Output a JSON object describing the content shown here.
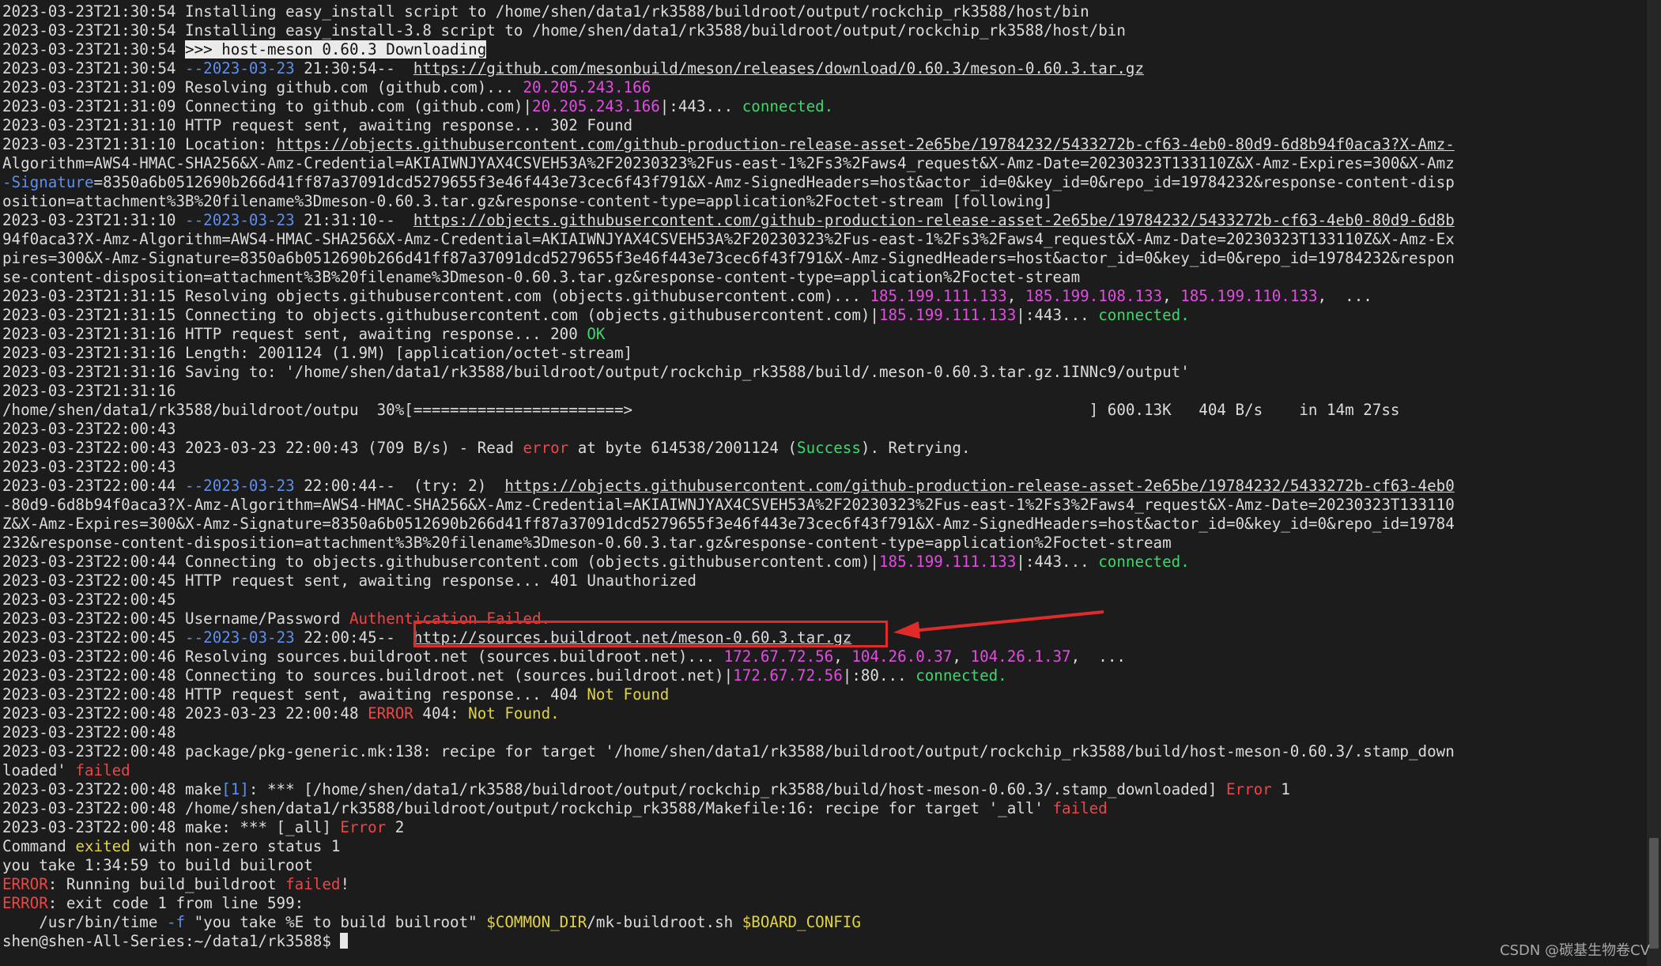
{
  "terminal": {
    "lines": [
      [
        [
          "2023-03-23T21:30:54 Installing easy_install script to /home/shen/data1/rk3588/buildroot/output/rockchip_rk3588/host/bin",
          ""
        ]
      ],
      [
        [
          "2023-03-23T21:30:54 Installing easy_install-3.8 script to /home/shen/data1/rk3588/buildroot/output/rockchip_rk3588/host/bin",
          ""
        ]
      ],
      [
        [
          "2023-03-23T21:30:54 ",
          ""
        ],
        [
          ">>> host-meson 0.60.3 Downloading",
          "hl"
        ]
      ],
      [
        [
          "2023-03-23T21:30:54 ",
          ""
        ],
        [
          "--2023-03-23",
          "c-blue"
        ],
        [
          " 21:30:54--  ",
          ""
        ],
        [
          "https://github.com/mesonbuild/meson/releases/download/0.60.3/meson-0.60.3.tar.gz",
          "url"
        ]
      ],
      [
        [
          "2023-03-23T21:31:09 Resolving github.com (github.com)... ",
          ""
        ],
        [
          "20.205.243.166",
          "c-mag"
        ]
      ],
      [
        [
          "2023-03-23T21:31:09 Connecting to github.com (github.com)|",
          ""
        ],
        [
          "20.205.243.166",
          "c-mag"
        ],
        [
          "|:443... ",
          ""
        ],
        [
          "connected.",
          "c-green"
        ]
      ],
      [
        [
          "2023-03-23T21:31:10 HTTP request sent, awaiting response... 302 Found",
          ""
        ]
      ],
      [
        [
          "2023-03-23T21:31:10 Location: ",
          ""
        ],
        [
          "https://objects.githubusercontent.com/github-production-release-asset-2e65be/19784232/5433272b-cf63-4eb0-80d9-6d8b94f0aca3?X-Amz-",
          "url"
        ]
      ],
      [
        [
          "Algorithm=AWS4-HMAC-SHA256&X-Amz-Credential=AKIAIWNJYAX4CSVEH53A%2F20230323%2Fus-east-1%2Fs3%2Faws4_request&X-Amz-Date=20230323T133110Z&X-Amz-Expires=300&X-Amz",
          ""
        ]
      ],
      [
        [
          "-Signature",
          "c-blue"
        ],
        [
          "=8350a6b0512690b266d41ff87a37091dcd5279655f3e46f443e73cec6f43f791&X-Amz-SignedHeaders=host&actor_id=0&key_id=0&repo_id=19784232&response-content-disp",
          ""
        ]
      ],
      [
        [
          "osition=attachment%3B%20filename%3Dmeson-0.60.3.tar.gz&response-content-type=application%2Foctet-stream [following]",
          ""
        ]
      ],
      [
        [
          "2023-03-23T21:31:10 ",
          ""
        ],
        [
          "--2023-03-23",
          "c-blue"
        ],
        [
          " 21:31:10--  ",
          ""
        ],
        [
          "https://objects.githubusercontent.com/github-production-release-asset-2e65be/19784232/5433272b-cf63-4eb0-80d9-6d8b",
          "url"
        ]
      ],
      [
        [
          "94f0aca3?X-Amz-Algorithm=AWS4-HMAC-SHA256&X-Amz-Credential=AKIAIWNJYAX4CSVEH53A%2F20230323%2Fus-east-1%2Fs3%2Faws4_request&X-Amz-Date=20230323T133110Z&X-Amz-Ex",
          ""
        ]
      ],
      [
        [
          "pires=300&X-Amz-Signature=8350a6b0512690b266d41ff87a37091dcd5279655f3e46f443e73cec6f43f791&X-Amz-SignedHeaders=host&actor_id=0&key_id=0&repo_id=19784232&respon",
          ""
        ]
      ],
      [
        [
          "se-content-disposition=attachment%3B%20filename%3Dmeson-0.60.3.tar.gz&response-content-type=application%2Foctet-stream",
          ""
        ]
      ],
      [
        [
          "2023-03-23T21:31:15 Resolving objects.githubusercontent.com (objects.githubusercontent.com)... ",
          ""
        ],
        [
          "185.199.111.133",
          "c-mag"
        ],
        [
          ", ",
          ""
        ],
        [
          "185.199.108.133",
          "c-mag"
        ],
        [
          ", ",
          ""
        ],
        [
          "185.199.110.133",
          "c-mag"
        ],
        [
          ",  ...",
          ""
        ]
      ],
      [
        [
          "2023-03-23T21:31:15 Connecting to objects.githubusercontent.com (objects.githubusercontent.com)|",
          ""
        ],
        [
          "185.199.111.133",
          "c-mag"
        ],
        [
          "|:443... ",
          ""
        ],
        [
          "connected.",
          "c-green"
        ]
      ],
      [
        [
          "2023-03-23T21:31:16 HTTP request sent, awaiting response... 200 ",
          ""
        ],
        [
          "OK",
          "c-green"
        ]
      ],
      [
        [
          "2023-03-23T21:31:16 Length: 2001124 (1.9M) [application/octet-stream]",
          ""
        ]
      ],
      [
        [
          "2023-03-23T21:31:16 Saving to: '/home/shen/data1/rk3588/buildroot/output/rockchip_rk3588/build/.meson-0.60.3.tar.gz.1INNc9/output'",
          ""
        ]
      ],
      [
        [
          "2023-03-23T21:31:16",
          ""
        ]
      ],
      [
        [
          "/home/shen/data1/rk3588/buildroot/outpu  30%[=======================>                                                  ] 600.13K   404 B/s    in 14m 27ss",
          ""
        ]
      ],
      [
        [
          "2023-03-23T22:00:43",
          ""
        ]
      ],
      [
        [
          "2023-03-23T22:00:43 2023-03-23 22:00:43 (709 B/s) - Read ",
          ""
        ],
        [
          "error",
          "c-red"
        ],
        [
          " at byte 614538/2001124 (",
          ""
        ],
        [
          "Success",
          "c-green"
        ],
        [
          "). Retrying.",
          ""
        ]
      ],
      [
        [
          "2023-03-23T22:00:43",
          ""
        ]
      ],
      [
        [
          "2023-03-23T22:00:44 ",
          ""
        ],
        [
          "--2023-03-23",
          "c-blue"
        ],
        [
          " 22:00:44--  (try: 2)  ",
          ""
        ],
        [
          "https://objects.githubusercontent.com/github-production-release-asset-2e65be/19784232/5433272b-cf63-4eb0",
          "url"
        ]
      ],
      [
        [
          "-80d9-6d8b94f0aca3?X-Amz-Algorithm=AWS4-HMAC-SHA256&X-Amz-Credential=AKIAIWNJYAX4CSVEH53A%2F20230323%2Fus-east-1%2Fs3%2Faws4_request&X-Amz-Date=20230323T133110",
          ""
        ]
      ],
      [
        [
          "Z&X-Amz-Expires=300&X-Amz-Signature=8350a6b0512690b266d41ff87a37091dcd5279655f3e46f443e73cec6f43f791&X-Amz-SignedHeaders=host&actor_id=0&key_id=0&repo_id=19784",
          ""
        ]
      ],
      [
        [
          "232&response-content-disposition=attachment%3B%20filename%3Dmeson-0.60.3.tar.gz&response-content-type=application%2Foctet-stream",
          ""
        ]
      ],
      [
        [
          "2023-03-23T22:00:44 Connecting to objects.githubusercontent.com (objects.githubusercontent.com)|",
          ""
        ],
        [
          "185.199.111.133",
          "c-mag"
        ],
        [
          "|:443... ",
          ""
        ],
        [
          "connected.",
          "c-green"
        ]
      ],
      [
        [
          "2023-03-23T22:00:45 HTTP request sent, awaiting response... 401 Unauthorized",
          ""
        ]
      ],
      [
        [
          "2023-03-23T22:00:45",
          ""
        ]
      ],
      [
        [
          "2023-03-23T22:00:45 Username/Password ",
          ""
        ],
        [
          "Authentication Failed.",
          "c-red"
        ]
      ],
      [
        [
          "2023-03-23T22:00:45 ",
          ""
        ],
        [
          "--2023-03-23",
          "c-blue"
        ],
        [
          " 22:00:45--  ",
          ""
        ],
        [
          "http://sources.buildroot.net/meson-0.60.3.tar.gz",
          "url"
        ]
      ],
      [
        [
          "2023-03-23T22:00:46 Resolving sources.buildroot.net (sources.buildroot.net)... ",
          ""
        ],
        [
          "172.67.72.56",
          "c-mag"
        ],
        [
          ", ",
          ""
        ],
        [
          "104.26.0.37",
          "c-mag"
        ],
        [
          ", ",
          ""
        ],
        [
          "104.26.1.37",
          "c-mag"
        ],
        [
          ",  ...",
          ""
        ]
      ],
      [
        [
          "2023-03-23T22:00:48 Connecting to sources.buildroot.net (sources.buildroot.net)|",
          ""
        ],
        [
          "172.67.72.56",
          "c-mag"
        ],
        [
          "|:80... ",
          ""
        ],
        [
          "connected.",
          "c-green"
        ]
      ],
      [
        [
          "2023-03-23T22:00:48 HTTP request sent, awaiting response... 404 ",
          ""
        ],
        [
          "Not Found",
          "c-yellow"
        ]
      ],
      [
        [
          "2023-03-23T22:00:48 2023-03-23 22:00:48 ",
          ""
        ],
        [
          "ERROR",
          "c-red"
        ],
        [
          " 404: ",
          ""
        ],
        [
          "Not Found.",
          "c-yellow"
        ]
      ],
      [
        [
          "2023-03-23T22:00:48",
          ""
        ]
      ],
      [
        [
          "2023-03-23T22:00:48 package/pkg-generic.mk:138: recipe for target '/home/shen/data1/rk3588/buildroot/output/rockchip_rk3588/build/host-meson-0.60.3/.stamp_down",
          ""
        ]
      ],
      [
        [
          "loaded' ",
          ""
        ],
        [
          "failed",
          "c-red"
        ]
      ],
      [
        [
          "2023-03-23T22:00:48 make",
          ""
        ],
        [
          "[1]",
          "c-blue"
        ],
        [
          ": *** [/home/shen/data1/rk3588/buildroot/output/rockchip_rk3588/build/host-meson-0.60.3/.stamp_downloaded] ",
          ""
        ],
        [
          "Error",
          "c-red"
        ],
        [
          " 1",
          ""
        ]
      ],
      [
        [
          "2023-03-23T22:00:48 /home/shen/data1/rk3588/buildroot/output/rockchip_rk3588/Makefile:16: recipe for target '_all' ",
          ""
        ],
        [
          "failed",
          "c-red"
        ]
      ],
      [
        [
          "2023-03-23T22:00:48 make: *** [_all] ",
          ""
        ],
        [
          "Error",
          "c-red"
        ],
        [
          " 2",
          ""
        ]
      ],
      [
        [
          "Command ",
          ""
        ],
        [
          "exited",
          "c-yellow"
        ],
        [
          " with non-zero status 1",
          ""
        ]
      ],
      [
        [
          "you take 1:34:59 to build builroot",
          ""
        ]
      ],
      [
        [
          "ERROR",
          "c-red"
        ],
        [
          ": Running build_buildroot ",
          ""
        ],
        [
          "failed",
          "c-red"
        ],
        [
          "!",
          ""
        ]
      ],
      [
        [
          "ERROR",
          "c-red"
        ],
        [
          ": exit code 1 from line 599:",
          ""
        ]
      ],
      [
        [
          "    /usr/bin/time ",
          ""
        ],
        [
          "-f",
          "c-blue"
        ],
        [
          " \"you take %E to build builroot\" ",
          ""
        ],
        [
          "$COMMON_DIR",
          "c-yellow"
        ],
        [
          "/mk-buildroot.sh ",
          ""
        ],
        [
          "$BOARD_CONFIG",
          "c-yellow"
        ]
      ],
      [
        [
          "shen@shen-All-Series:~/data1/rk3588$ ",
          ""
        ]
      ]
    ]
  },
  "watermark": "CSDN @碳基生物卷CV",
  "annotation": {
    "color": "#e12a2a"
  }
}
